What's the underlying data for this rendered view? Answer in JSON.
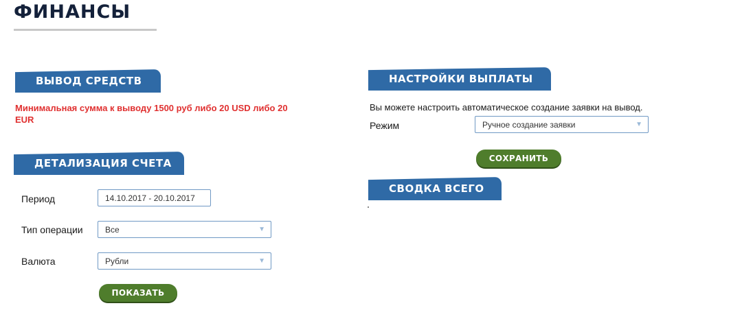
{
  "page": {
    "title": "ФИНАНСЫ"
  },
  "withdraw": {
    "heading": "ВЫВОД СРЕДСТВ",
    "min_notice": "Минимальная сумма к выводу 1500 руб либо 20 USD либо 20 EUR"
  },
  "details": {
    "heading": "ДЕТАЛИЗАЦИЯ СЧЕТА",
    "period_label": "Период",
    "period_value": "14.10.2017 - 20.10.2017",
    "operation_label": "Тип операции",
    "operation_value": "Все",
    "currency_label": "Валюта",
    "currency_value": "Рубли",
    "show_button": "ПОКАЗАТЬ"
  },
  "payout": {
    "heading": "НАСТРОЙКИ ВЫПЛАТЫ",
    "info": "Вы можете настроить автоматическое создание заявки на вывод.",
    "mode_label": "Режим",
    "mode_value": "Ручное создание заявки",
    "save_button": "СОХРАНИТЬ"
  },
  "summary": {
    "heading": "СВОДКА ВСЕГО"
  },
  "icons": {
    "dropdown": "chevron-down-icon"
  },
  "colors": {
    "tab_blue": "#2f6aa6",
    "button_green": "#4f7d2c",
    "warning_red": "#e03030",
    "title_navy": "#14213a"
  }
}
